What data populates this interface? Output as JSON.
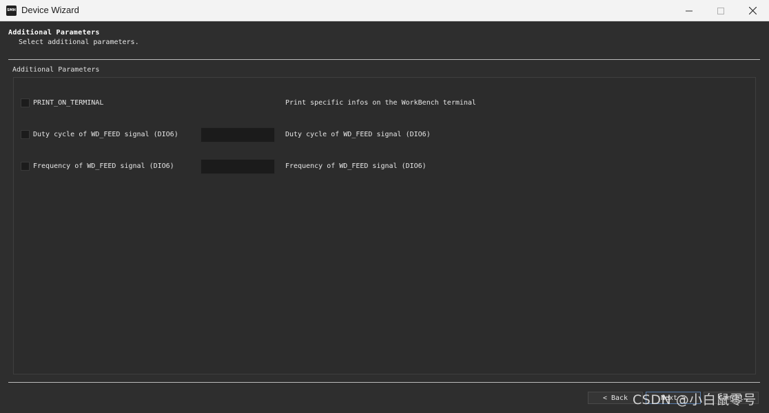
{
  "window": {
    "title": "Device Wizard",
    "icon_text": "SMH",
    "controls": [
      "minimize-icon",
      "maximize-icon",
      "close-icon"
    ]
  },
  "header": {
    "title": "Additional Parameters",
    "subtitle": "Select additional parameters."
  },
  "group": {
    "title": "Additional Parameters"
  },
  "params": [
    {
      "label": "PRINT_ON_TERMINAL",
      "checked": false,
      "has_input": false,
      "description": "Print specific infos on the WorkBench terminal"
    },
    {
      "label": "Duty cycle of WD_FEED signal (DIO6)",
      "checked": false,
      "has_input": true,
      "value": "",
      "description": "Duty cycle of WD_FEED signal (DIO6)"
    },
    {
      "label": "Frequency of WD_FEED signal (DIO6)",
      "checked": false,
      "has_input": true,
      "value": "",
      "description": "Frequency of WD_FEED signal (DIO6)"
    }
  ],
  "buttons": {
    "back": "< Back",
    "back_icon": "chevron-left-icon",
    "next": "Next >",
    "cancel": "Cancel"
  },
  "watermark": "CSDN @小白鼠零号",
  "colors": {
    "background": "#2e2e2e",
    "titlebar": "#f3f3f3",
    "input_bg": "#1b1b1b",
    "focus_border": "#5a7fae"
  }
}
